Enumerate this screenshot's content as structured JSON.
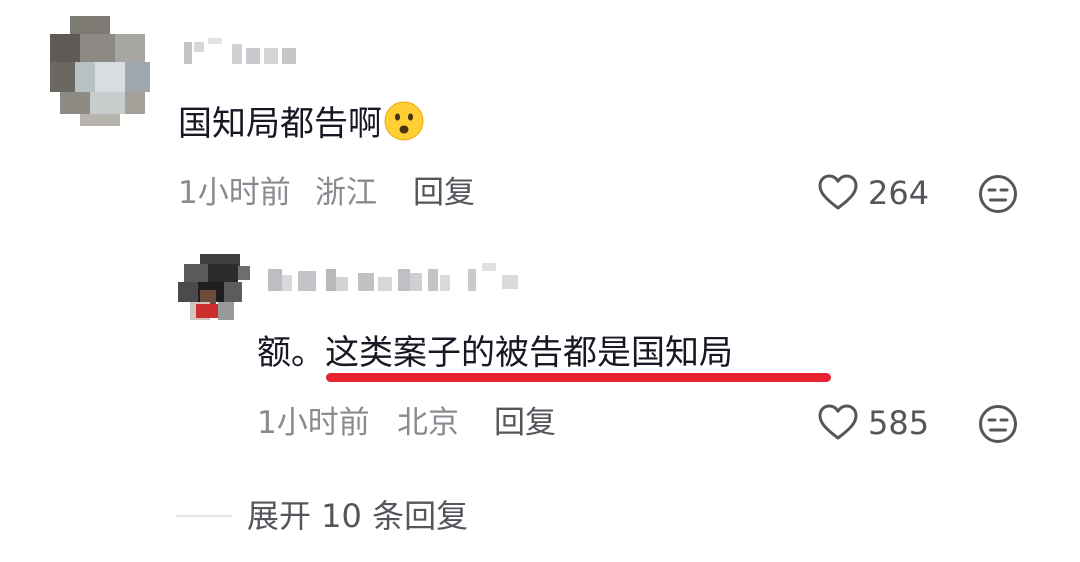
{
  "comment": {
    "text": "国知局都告啊",
    "emoji_icon": "frowning-face-emoji",
    "time": "1小时前",
    "location": "浙江",
    "reply_label": "回复",
    "like_count": "264",
    "like_icon": "heart-outline-icon",
    "dislike_icon": "meh-face-icon"
  },
  "reply": {
    "prefix": "额。",
    "highlighted_text": "这类案子的被告都是国知局",
    "underline_color": "#e8232f",
    "time": "1小时前",
    "location": "北京",
    "reply_label": "回复",
    "like_count": "585",
    "like_icon": "heart-outline-icon",
    "dislike_icon": "meh-face-icon"
  },
  "expand": {
    "label": "展开 10 条回复"
  },
  "colors": {
    "primary_text": "#161823",
    "secondary_text": "#8a8b91",
    "action_text": "#55565c",
    "highlight": "#e8232f"
  }
}
